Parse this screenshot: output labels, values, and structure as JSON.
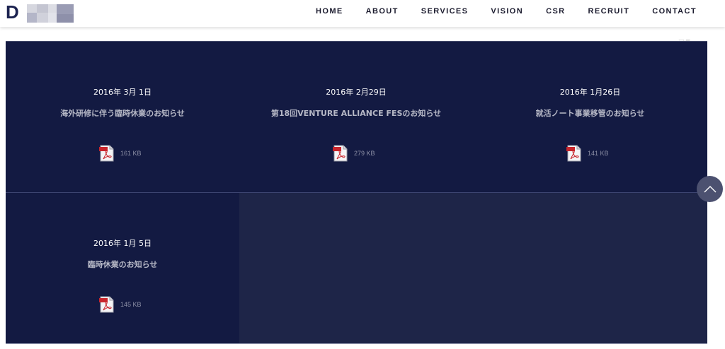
{
  "header": {
    "logo_letter": "D",
    "nav": [
      "HOME",
      "ABOUT",
      "SERVICES",
      "VISION",
      "CSR",
      "RECRUIT",
      "CONTACT"
    ]
  },
  "notices": [
    {
      "date": "2016年 3月 1日",
      "title": "海外研修に伴う臨時休業のお知らせ",
      "file_size": "161 KB",
      "file_icon": "pdf-icon"
    },
    {
      "date": "2016年 2月29日",
      "title": "第18回VENTURE ALLIANCE FESのお知らせ",
      "file_size": "279 KB",
      "file_icon": "pdf-icon"
    },
    {
      "date": "2016年 1月26日",
      "title": "就活ノート事業移管のお知らせ",
      "file_size": "141 KB",
      "file_icon": "pdf-icon"
    },
    {
      "date": "2016年 1月 5日",
      "title": "臨時休業のお知らせ",
      "file_size": "145 KB",
      "file_icon": "pdf-icon"
    }
  ],
  "scroll_top_icon": "chevron-up-icon",
  "colors": {
    "panel_bg": "#1e2548",
    "cell_bg": "#131a42",
    "nav_text": "#1b1b2e",
    "pdf_red": "#c8252c"
  }
}
